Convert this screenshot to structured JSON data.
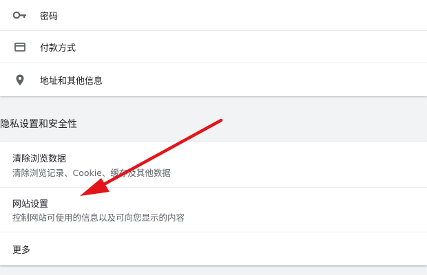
{
  "autofill": {
    "items": [
      {
        "label": "密码",
        "icon": "key-icon"
      },
      {
        "label": "付款方式",
        "icon": "credit-card-icon"
      },
      {
        "label": "地址和其他信息",
        "icon": "location-pin-icon"
      }
    ]
  },
  "privacy": {
    "title": "隐私设置和安全性",
    "items": [
      {
        "title": "清除浏览数据",
        "subtitle": "清除浏览记录、Cookie、缓存及其他数据"
      },
      {
        "title": "网站设置",
        "subtitle": "控制网站可使用的信息以及可向您显示的内容"
      },
      {
        "title": "更多"
      }
    ]
  },
  "colors": {
    "page_bg": "#f1f3f4",
    "card_bg": "#ffffff",
    "divider": "#e8eaed",
    "arrow": "#e3151a",
    "icon": "#5f6368"
  }
}
